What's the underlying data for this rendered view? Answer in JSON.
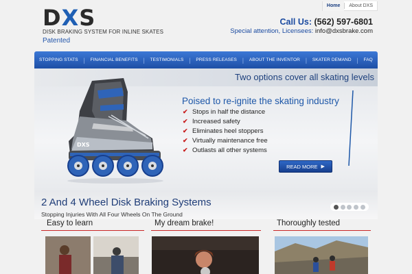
{
  "brand": {
    "logo_d": "D",
    "logo_x": "X",
    "logo_s": "S",
    "tagline": "DISK BRAKING SYSTEM FOR INLINE SKATES",
    "patented": "Patented"
  },
  "topnav": {
    "home": "Home",
    "about": "About DXS"
  },
  "contact": {
    "call_label": "Call Us:",
    "phone": "(562) 597-6801",
    "special_label": "Special attention, Licensees:",
    "email": "info@dxsbrake.com"
  },
  "nav": {
    "items": [
      "STOPPING STATS",
      "FINANCIAL BENEFITS",
      "TESTIMONIALS",
      "PRESS RELEASES",
      "ABOUT THE INVENTOR",
      "SKATER DEMAND",
      "FAQ"
    ]
  },
  "hero": {
    "two_options": "Two options cover all skating levels",
    "headline": "Poised to re-ignite the skating industry",
    "bullets": [
      "Stops in half the distance",
      "Increased safety",
      "Eliminates heel stoppers",
      "Virtually maintenance free",
      "Outlasts all other systems"
    ],
    "read_more": "READ MORE",
    "skate_brand": "DXS"
  },
  "section": {
    "title": "2 And 4 Wheel Disk Braking Systems",
    "subtitle": "Stopping Injuries With All Four Wheels On The Ground",
    "slides": 5,
    "active_slide": 1
  },
  "cards": [
    {
      "title": "Easy to learn"
    },
    {
      "title": "My dream brake!"
    },
    {
      "title": "Thoroughly tested"
    }
  ],
  "colors": {
    "accent_blue": "#1f5fb4",
    "nav_blue": "#2a62c0",
    "check_red": "#c81c1c",
    "divider_red": "#c92424"
  }
}
